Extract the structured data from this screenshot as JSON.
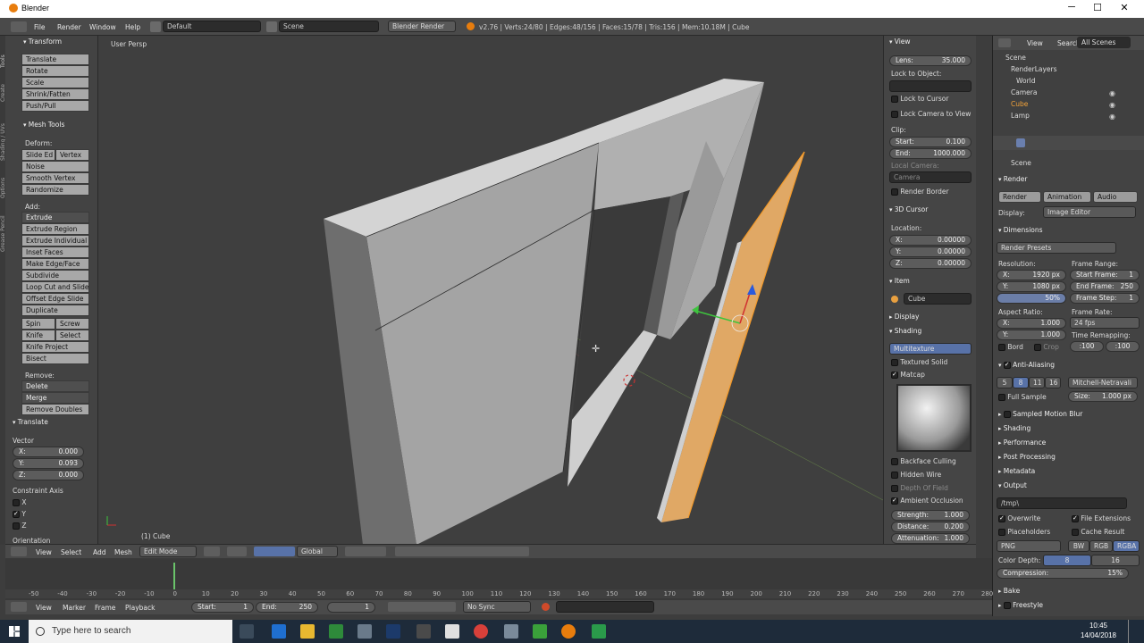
{
  "window": {
    "title": "Blender",
    "minimize": "─",
    "maximize": "☐",
    "close": "✕"
  },
  "menu": [
    "File",
    "Render",
    "Window",
    "Help"
  ],
  "info": {
    "screen": "Default",
    "scene": "Scene",
    "engine": "Blender Render",
    "stats": "v2.76 | Verts:24/80 | Edges:48/156 | Faces:15/78 | Tris:156 | Mem:10.18M | Cube"
  },
  "toolshelf": {
    "transform_header": "Transform",
    "transform": [
      "Translate",
      "Rotate",
      "Scale",
      "Shrink/Fatten",
      "Push/Pull"
    ],
    "mesh_tools_header": "Mesh Tools",
    "deform_label": "Deform:",
    "slide_edge": "Slide Ed",
    "vertex": "Vertex",
    "noise": "Noise",
    "smooth_vertex": "Smooth Vertex",
    "randomize": "Randomize",
    "add_label": "Add:",
    "extrude": "Extrude",
    "add_tools": [
      "Extrude Region",
      "Extrude Individual",
      "Inset Faces",
      "Make Edge/Face",
      "Subdivide",
      "Loop Cut and Slide",
      "Offset Edge Slide",
      "Duplicate"
    ],
    "spin": "Spin",
    "screw": "Screw",
    "knife": "Knife",
    "select": "Select",
    "knife_project": "Knife Project",
    "bisect": "Bisect",
    "remove_label": "Remove:",
    "delete": "Delete",
    "merge": "Merge",
    "remove_doubles": "Remove Doubles",
    "translate_header": "Translate",
    "vector_label": "Vector",
    "x_label": "X:",
    "x_val": "0.000",
    "y_label": "Y:",
    "y_val": "0.093",
    "z_label": "Z:",
    "z_val": "0.000",
    "constraint_label": "Constraint Axis",
    "cx": "X",
    "cy": "Y",
    "cz": "Z",
    "orientation_label": "Orientation"
  },
  "vertical_tabs": [
    "Tools",
    "Create",
    "Shading / UVs",
    "Options",
    "Grease Pencil"
  ],
  "viewport": {
    "label": "User Persp",
    "object_label": "(1) Cube"
  },
  "npanel": {
    "view_header": "View",
    "lens_label": "Lens:",
    "lens_val": "35.000",
    "lock_to_object": "Lock to Object:",
    "lock_to_cursor": "Lock to Cursor",
    "lock_camera": "Lock Camera to View",
    "clip": "Clip:",
    "start_label": "Start:",
    "start_val": "0.100",
    "end_label": "End:",
    "end_val": "1000.000",
    "local_camera": "Local Camera:",
    "camera": "Camera",
    "render_border": "Render Border",
    "cursor_header": "3D Cursor",
    "location": "Location:",
    "cx_label": "X:",
    "cx_val": "0.00000",
    "cy_label": "Y:",
    "cy_val": "0.00000",
    "cz_label": "Z:",
    "cz_val": "0.00000",
    "item_header": "Item",
    "item_name": "Cube",
    "display_header": "Display",
    "shading_header": "Shading",
    "shade_mode": "Multitexture",
    "textured_solid": "Textured Solid",
    "matcap": "Matcap",
    "backface": "Backface Culling",
    "hidden_wire": "Hidden Wire",
    "dof": "Depth Of Field",
    "ao": "Ambient Occlusion",
    "strength_label": "Strength:",
    "strength_val": "1.000",
    "distance_label": "Distance:",
    "distance_val": "0.200",
    "atten_label": "Attenuation:",
    "atten_val": "1.000"
  },
  "outliner": {
    "view": "View",
    "search": "Search",
    "all_scenes": "All Scenes",
    "items": [
      "Scene",
      "RenderLayers",
      "World",
      "Camera",
      "Cube",
      "Lamp"
    ]
  },
  "properties": {
    "scene": "Scene",
    "render_header": "Render",
    "render_btn": "Render",
    "animation_btn": "Animation",
    "audio_btn": "Audio",
    "display_label": "Display:",
    "display_val": "Image Editor",
    "dimensions_header": "Dimensions",
    "render_presets": "Render Presets",
    "resolution_label": "Resolution:",
    "res_x_label": "X:",
    "res_x": "1920 px",
    "res_y_label": "Y:",
    "res_y": "1080 px",
    "res_pct": "50%",
    "frame_range": "Frame Range:",
    "start_frame": "Start Frame:",
    "start_frame_val": "1",
    "end_frame": "End Frame:",
    "end_frame_val": "250",
    "frame_step": "Frame Step:",
    "frame_step_val": "1",
    "aspect_label": "Aspect Ratio:",
    "asp_x_label": "X:",
    "asp_x": "1.000",
    "asp_y_label": "Y:",
    "asp_y": "1.000",
    "frame_rate": "Frame Rate:",
    "fps": "24 fps",
    "time_remap": "Time Remapping:",
    "old": ":100",
    "new": ":100",
    "bord": "Bord",
    "crop": "Crop",
    "aa_header": "Anti-Aliasing",
    "aa_5": "5",
    "aa_8": "8",
    "aa_11": "11",
    "aa_16": "16",
    "filter": "Mitchell-Netravali",
    "full_sample": "Full Sample",
    "size_label": "Size:",
    "size_val": "1.000 px",
    "sampled_motion": "Sampled Motion Blur",
    "shading": "Shading",
    "performance": "Performance",
    "post_processing": "Post Processing",
    "metadata": "Metadata",
    "output": "Output",
    "output_path": "/tmp\\",
    "overwrite": "Overwrite",
    "file_ext": "File Extensions",
    "placeholders": "Placeholders",
    "cache_result": "Cache Result",
    "format": "PNG",
    "bw": "BW",
    "rgb": "RGB",
    "rgba": "RGBA",
    "color_depth": "Color Depth:",
    "cd8": "8",
    "cd16": "16",
    "compression_label": "Compression:",
    "compression_val": "15%",
    "bake": "Bake",
    "freestyle": "Freestyle"
  },
  "vpheader": {
    "view": "View",
    "select": "Select",
    "add": "Add",
    "mesh": "Mesh",
    "mode": "Edit Mode",
    "orientation": "Global"
  },
  "timeline": {
    "ticks": [
      "-50",
      "-40",
      "-30",
      "-20",
      "-10",
      "0",
      "10",
      "20",
      "30",
      "40",
      "50",
      "60",
      "70",
      "80",
      "90",
      "100",
      "110",
      "120",
      "130",
      "140",
      "150",
      "160",
      "170",
      "180",
      "190",
      "200",
      "210",
      "220",
      "230",
      "240",
      "250",
      "260",
      "270",
      "280"
    ],
    "view": "View",
    "marker": "Marker",
    "frame": "Frame",
    "playback": "Playback",
    "start_label": "Start:",
    "start_val": "1",
    "end_label": "End:",
    "end_val": "250",
    "current": "1",
    "sync": "No Sync"
  },
  "taskbar": {
    "search_placeholder": "Type here to search",
    "time": "10:45",
    "date": "14/04/2018"
  }
}
